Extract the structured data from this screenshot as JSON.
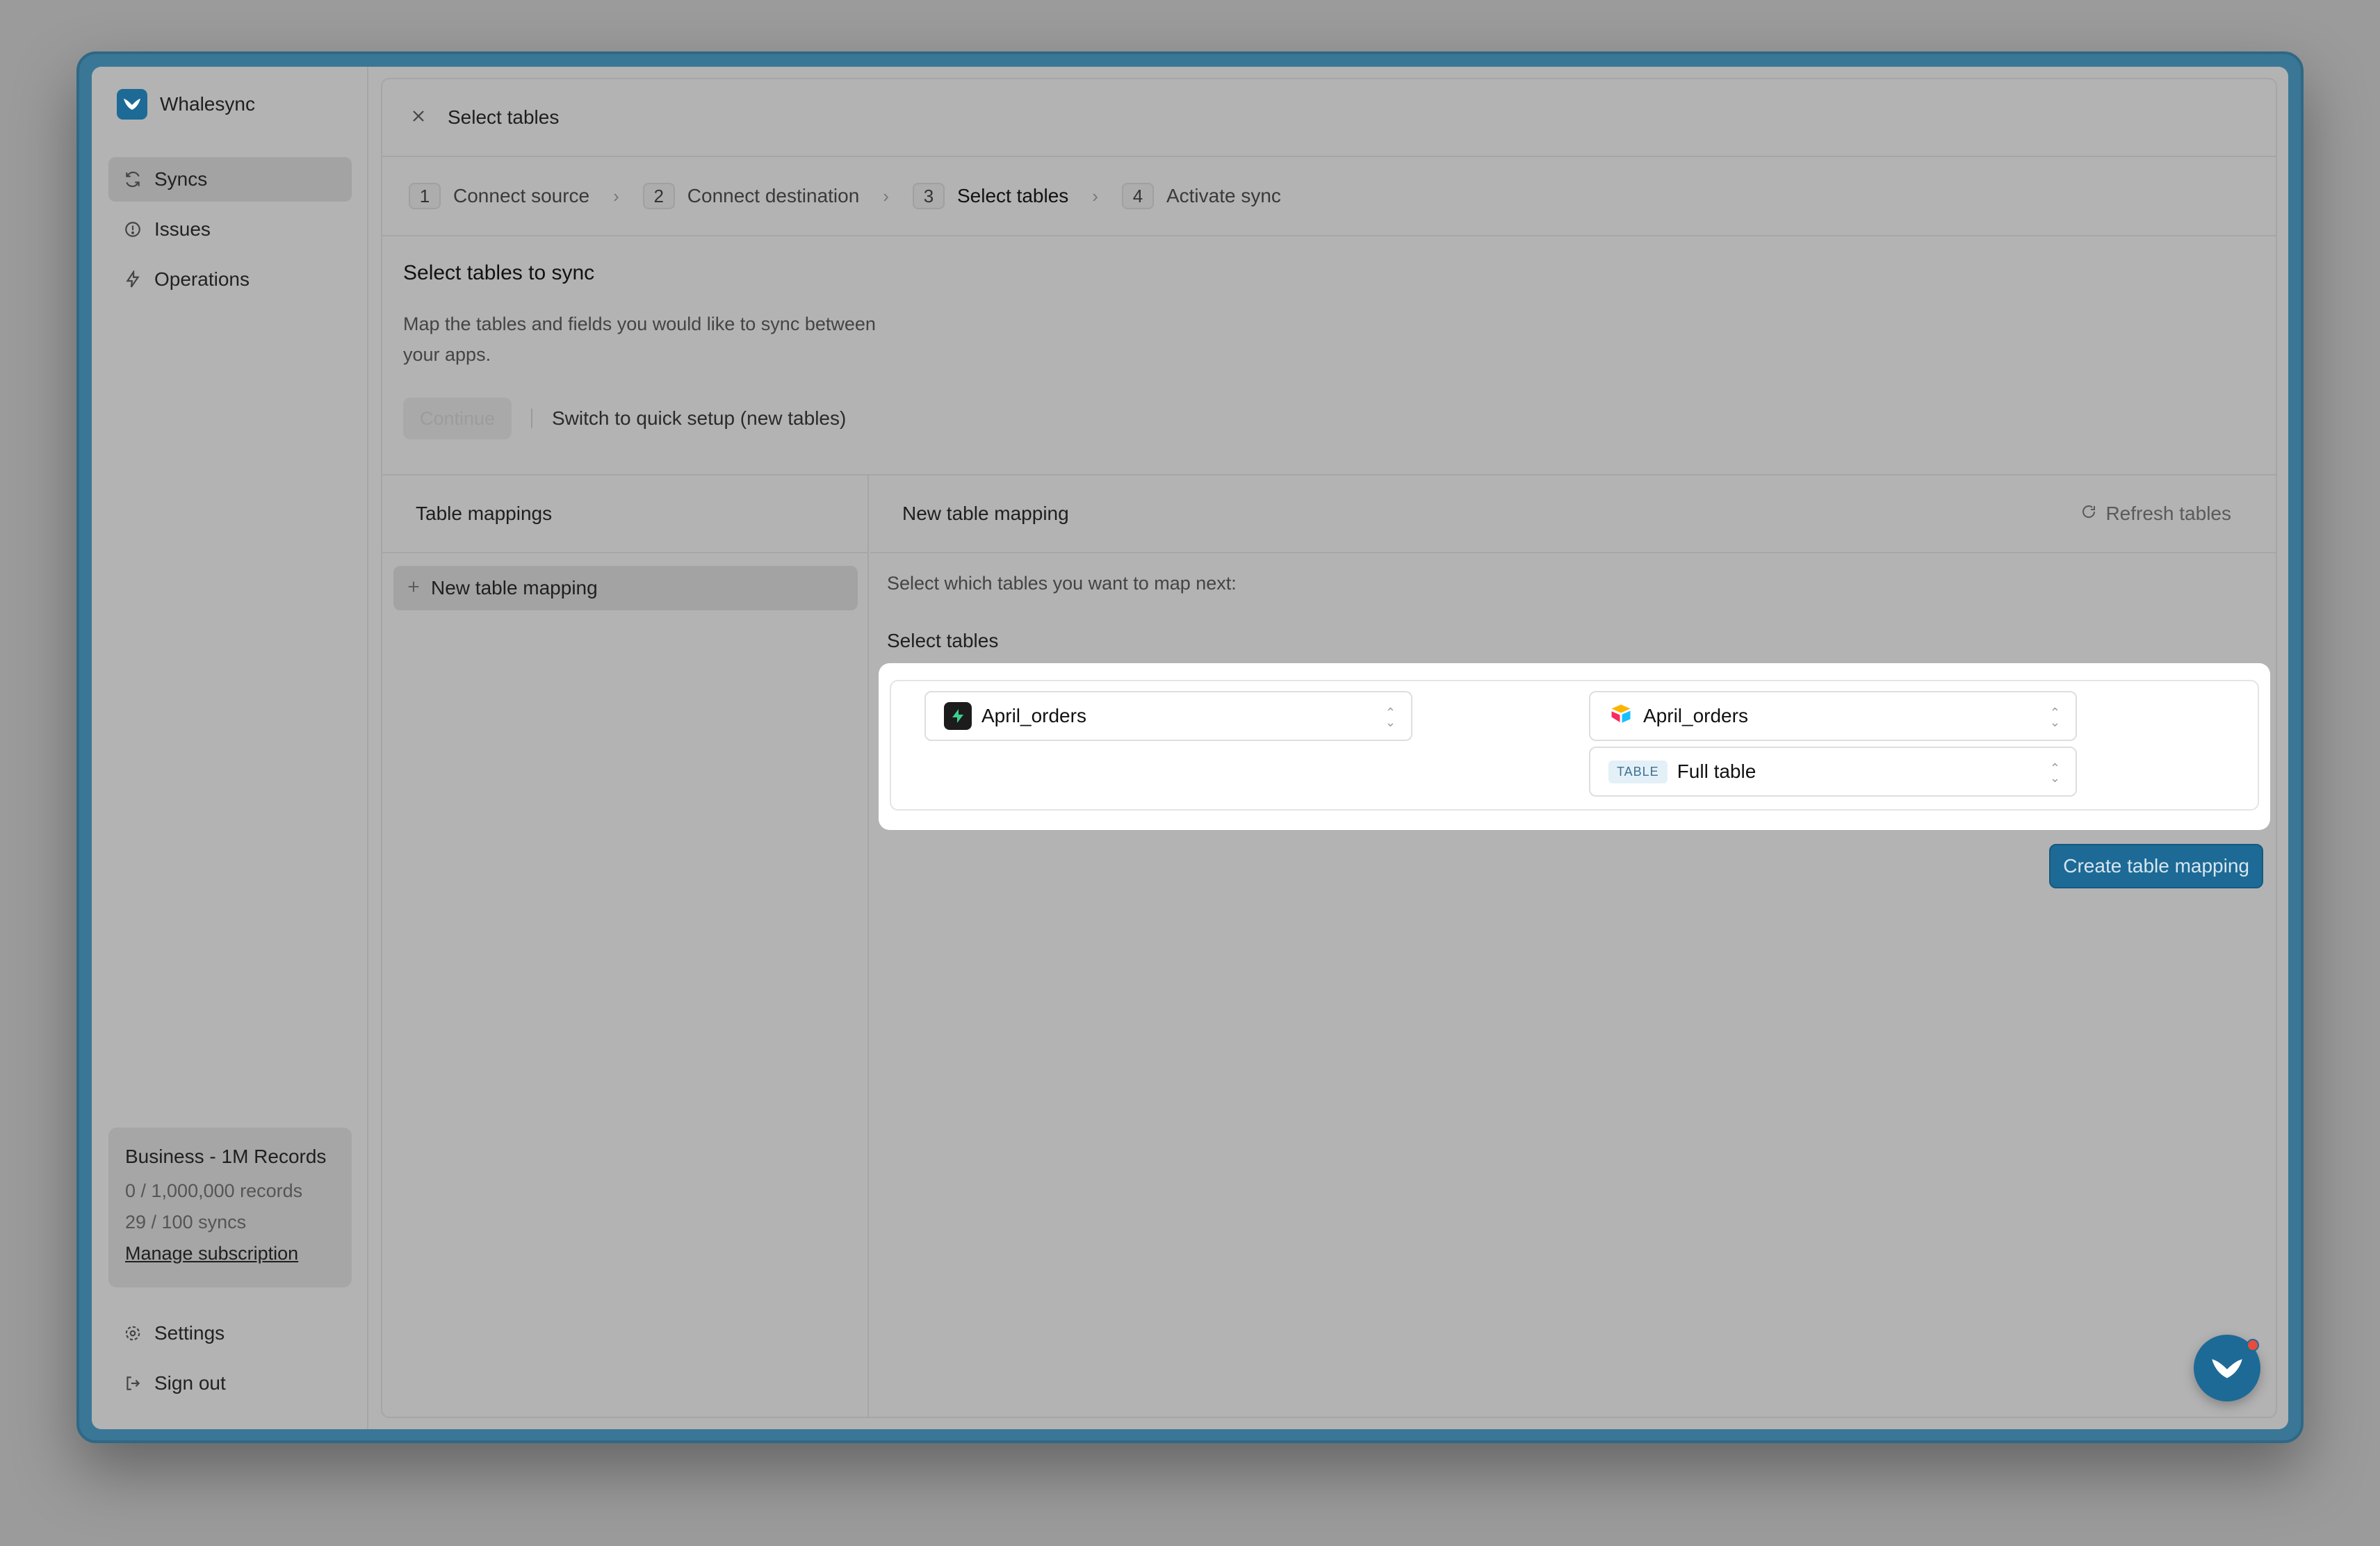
{
  "brand": {
    "name": "Whalesync"
  },
  "sidebar": {
    "items": [
      {
        "label": "Syncs",
        "icon": "refresh-icon",
        "active": true
      },
      {
        "label": "Issues",
        "icon": "alert-circle-icon",
        "active": false
      },
      {
        "label": "Operations",
        "icon": "lightning-icon",
        "active": false
      }
    ],
    "plan": {
      "title": "Business - 1M Records",
      "records": "0 / 1,000,000 records",
      "syncs": "29 / 100 syncs",
      "manage_link": "Manage subscription"
    },
    "bottom": [
      {
        "label": "Settings",
        "icon": "gear-icon"
      },
      {
        "label": "Sign out",
        "icon": "sign-out-icon"
      }
    ]
  },
  "header": {
    "title": "Select tables"
  },
  "steps": [
    {
      "num": "1",
      "label": "Connect source"
    },
    {
      "num": "2",
      "label": "Connect destination"
    },
    {
      "num": "3",
      "label": "Select tables",
      "current": true
    },
    {
      "num": "4",
      "label": "Activate sync"
    }
  ],
  "intro": {
    "title": "Select tables to sync",
    "desc": "Map the tables and fields you would like to sync between your apps.",
    "continue_label": "Continue",
    "quick_setup": "Switch to quick setup (new tables)"
  },
  "left_panel": {
    "header": "Table mappings",
    "item": "New table mapping"
  },
  "right_panel": {
    "header": "New table mapping",
    "refresh": "Refresh tables",
    "hint": "Select which tables you want to map next:",
    "select_label": "Select tables",
    "source_table": "April_orders",
    "dest_table": "April_orders",
    "view_tag": "TABLE",
    "view_value": "Full table",
    "create_button": "Create table mapping"
  },
  "colors": {
    "accent": "#1d6a96",
    "notification": "#e74c3c"
  }
}
